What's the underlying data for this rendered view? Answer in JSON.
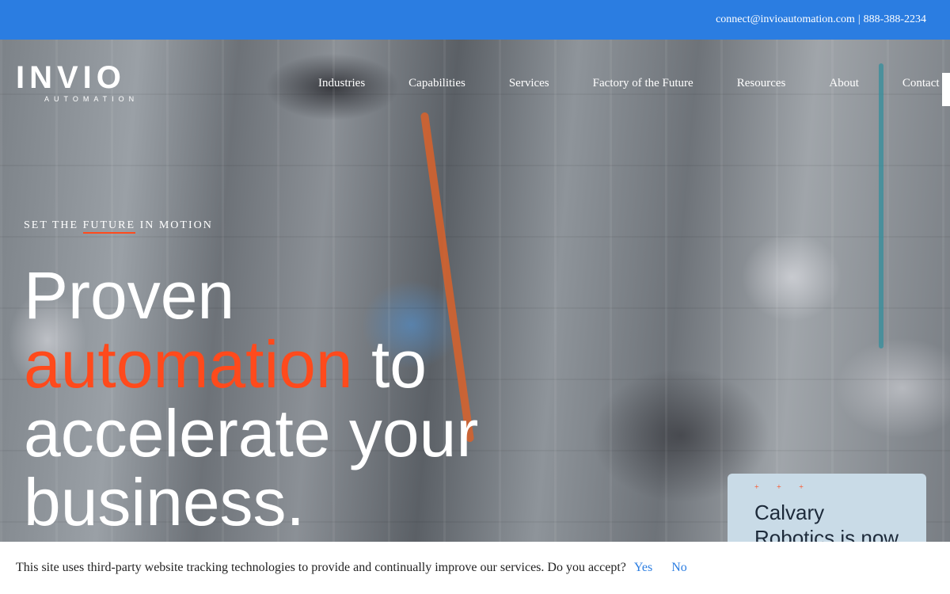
{
  "topbar": {
    "email": "connect@invioautomation.com",
    "separator": "|",
    "phone": "888-388-2234"
  },
  "logo": {
    "wordmark": "INVIO",
    "subtitle": "AUTOMATION"
  },
  "nav": {
    "items": [
      {
        "label": "Industries"
      },
      {
        "label": "Capabilities"
      },
      {
        "label": "Services"
      },
      {
        "label": "Factory of the Future"
      },
      {
        "label": "Resources"
      },
      {
        "label": "About"
      },
      {
        "label": "Contact"
      }
    ]
  },
  "hero": {
    "eyebrow_pre": "SET THE ",
    "eyebrow_highlight": "FUTURE",
    "eyebrow_post": " IN MOTION",
    "headline_line1": "Proven",
    "headline_accent": "automation",
    "headline_to": " to",
    "headline_line3": "accelerate your",
    "headline_line4": "business.",
    "accent_color": "#ff4a1c"
  },
  "news_card": {
    "stars": "+ + +",
    "title": "Calvary Robotics is now part of"
  },
  "cookie_banner": {
    "message": "This site uses third-party website tracking technologies to provide and continually improve our services. Do you accept?",
    "yes_label": "Yes",
    "no_label": "No"
  },
  "colors": {
    "topbar": "#2b7de1",
    "accent": "#ff4a1c",
    "card": "#c9dbe7",
    "link": "#2b7de1"
  }
}
